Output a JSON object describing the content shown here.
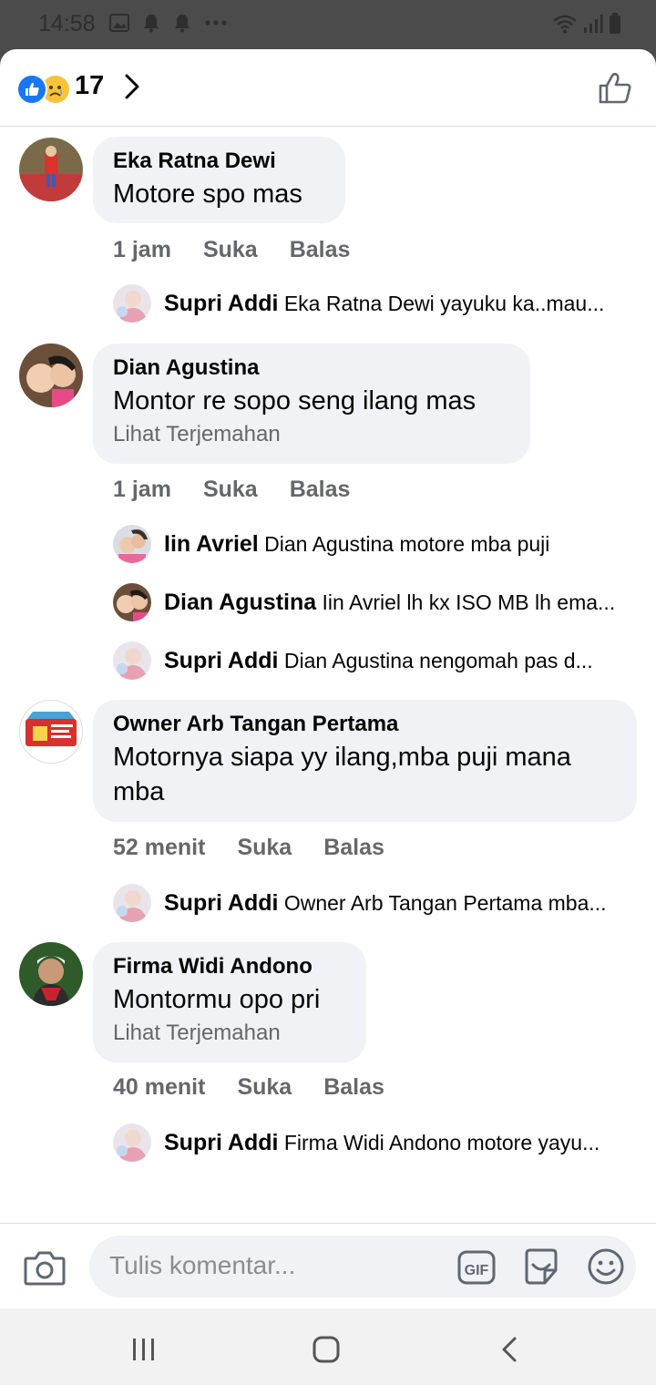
{
  "status_bar": {
    "time": "14:58"
  },
  "header": {
    "reaction_count": "17"
  },
  "comments": [
    {
      "name": "Eka Ratna Dewi",
      "text": "Motore spo mas",
      "translate": "",
      "time": "1 jam",
      "like_label": "Suka",
      "reply_label": "Balas",
      "replies": [
        {
          "name": "Supri Addi",
          "text": "Eka Ratna Dewi yayuku ka..mau..."
        }
      ]
    },
    {
      "name": "Dian Agustina",
      "text": "Montor re sopo seng ilang mas",
      "translate": "Lihat Terjemahan",
      "time": "1 jam",
      "like_label": "Suka",
      "reply_label": "Balas",
      "replies": [
        {
          "name": "Iin Avriel",
          "text": "Dian Agustina  motore mba puji"
        },
        {
          "name": "Dian Agustina",
          "text": "Iin Avriel lh kx ISO MB lh ema..."
        },
        {
          "name": "Supri Addi",
          "text": "Dian Agustina nengomah  pas d..."
        }
      ]
    },
    {
      "name": "Owner Arb Tangan Pertama",
      "text": "Motornya siapa yy ilang,mba puji mana mba",
      "translate": "",
      "time": "52 menit",
      "like_label": "Suka",
      "reply_label": "Balas",
      "replies": [
        {
          "name": "Supri Addi",
          "text": "Owner Arb Tangan Pertama mba..."
        }
      ]
    },
    {
      "name": "Firma Widi Andono",
      "text": "Montormu opo pri",
      "translate": "Lihat Terjemahan",
      "time": "40 menit",
      "like_label": "Suka",
      "reply_label": "Balas",
      "replies": [
        {
          "name": "Supri Addi",
          "text": "Firma Widi Andono motore yayu..."
        }
      ]
    }
  ],
  "composer": {
    "placeholder": "Tulis komentar..."
  },
  "icons": {
    "reaction_like": "like-reaction-icon",
    "reaction_sad": "sad-reaction-icon",
    "chevron": "chevron-right-icon",
    "like_button": "thumbs-up-icon",
    "camera": "camera-icon",
    "gif": "gif-icon",
    "sticker": "sticker-icon",
    "emoji": "emoji-icon"
  },
  "colors": {
    "accent": "#1877f2",
    "bubble": "#f0f2f5",
    "meta_text": "#65676b"
  }
}
